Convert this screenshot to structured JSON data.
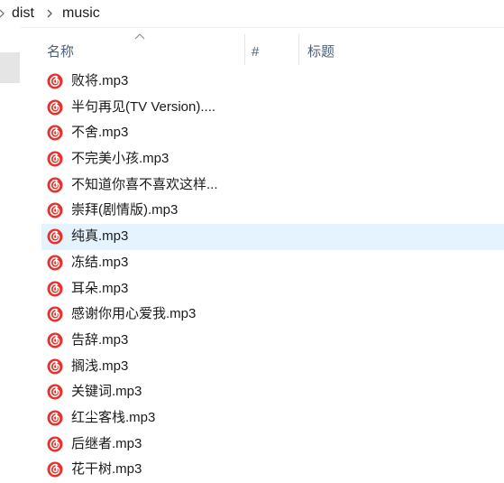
{
  "breadcrumb": {
    "items": [
      "dist",
      "music"
    ]
  },
  "columns": {
    "name": "名称",
    "number": "#",
    "title": "标题"
  },
  "files": [
    "败将.mp3",
    "半句再见(TV Version)....",
    "不舍.mp3",
    "不完美小孩.mp3",
    "不知道你喜不喜欢这样...",
    "崇拜(剧情版).mp3",
    "纯真.mp3",
    "冻结.mp3",
    "耳朵.mp3",
    "感谢你用心爱我.mp3",
    "告辞.mp3",
    "搁浅.mp3",
    "关键词.mp3",
    "红尘客栈.mp3",
    "后继者.mp3",
    "花干树.mp3"
  ],
  "selected_index": 6,
  "icon": "netease-cloud-music-icon",
  "colors": {
    "icon_red": "#e5322d",
    "selected_row": "#e5f3ff",
    "header_text": "#4c607a"
  }
}
